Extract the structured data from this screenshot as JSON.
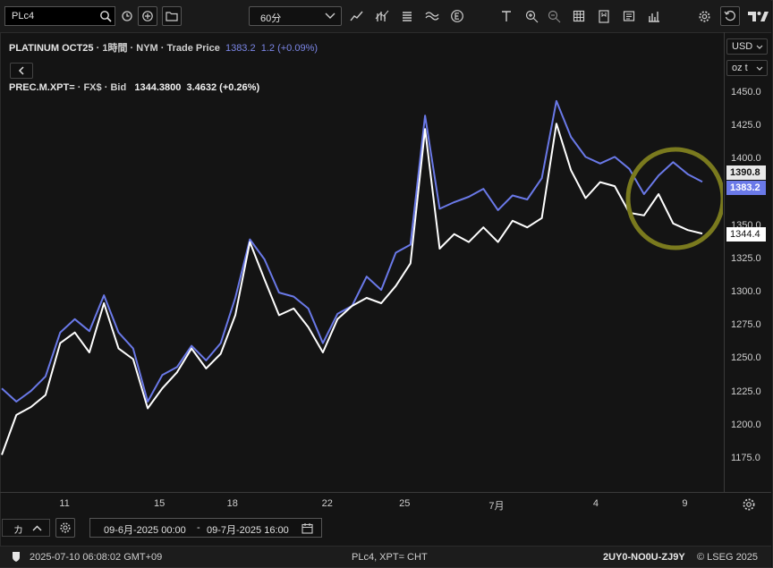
{
  "toolbar": {
    "ric": "PLc4",
    "interval": "60分",
    "icons": [
      "search-icon",
      "clock-icon",
      "add-icon",
      "folder-icon",
      "line-chart-icon",
      "ohlc-icon",
      "list-icon",
      "wave-icon",
      "e-icon",
      "text-tool-icon",
      "zoom-in-icon",
      "zoom-out-icon",
      "table-icon",
      "bookmark-icon",
      "news-icon",
      "bar-chart-icon",
      "settings-icon",
      "reset-icon",
      "tradingview-logo"
    ]
  },
  "header1": {
    "symbol": "PLATINUM OCT25",
    "interval": "1時間",
    "exchange": "NYM",
    "field": "Trade Price",
    "price": "1383.2",
    "change": "1.2 (+0.09%)"
  },
  "header2": {
    "symbol": "PREC.M.XPT=",
    "ccy": "FX$",
    "field": "Bid",
    "price": "1344.3800",
    "change": "3.4632 (+0.26%)"
  },
  "axis": {
    "currency": "USD",
    "unit": "oz t"
  },
  "price_labels": {
    "gray": "1390.8",
    "blue": "1383.2",
    "white": "1344.4"
  },
  "bottom": {
    "k_label": "カ",
    "date_from": "09-6月-2025 00:00",
    "sep": "-",
    "date_to": "09-7月-2025 16:00"
  },
  "status": {
    "timestamp": "2025-07-10 06:08:02 GMT+09",
    "center": "PLc4, XPT= CHT",
    "id": "2UY0-NO0U-ZJ9Y",
    "copyright": "© LSEG 2025"
  },
  "colors": {
    "series_blue": "#6a79e8",
    "series_white": "#ffffff",
    "highlight": "#7a7a1e",
    "background": "#141414"
  },
  "chart_data": {
    "type": "line",
    "x_ticks": [
      "11",
      "15",
      "18",
      "22",
      "25",
      "7月",
      "4",
      "9"
    ],
    "x_tick_pos": [
      4.3,
      10.8,
      15.8,
      22.3,
      27.6,
      33.9,
      40.7,
      46.8
    ],
    "ylim": [
      1150,
      1460
    ],
    "y_ticks": [
      1175,
      1200,
      1225,
      1250,
      1275,
      1300,
      1325,
      1350,
      1375,
      1400,
      1425,
      1450
    ],
    "series": [
      {
        "name": "PLATINUM OCT25",
        "color": "#6a79e8",
        "x": [
          0,
          1,
          2,
          3,
          4,
          5,
          6,
          7,
          8,
          9,
          10,
          11,
          12,
          13,
          14,
          15,
          16,
          17,
          18,
          19,
          20,
          21,
          22,
          23,
          24,
          25,
          26,
          27,
          28,
          29,
          30,
          31,
          32,
          33,
          34,
          35,
          36,
          37,
          38,
          39,
          40,
          41,
          42,
          43,
          44,
          45,
          46,
          47,
          48
        ],
        "values": [
          1228,
          1218,
          1226,
          1237,
          1270,
          1280,
          1271,
          1298,
          1270,
          1258,
          1218,
          1238,
          1244,
          1260,
          1249,
          1262,
          1296,
          1340,
          1325,
          1300,
          1297,
          1288,
          1262,
          1284,
          1290,
          1312,
          1302,
          1330,
          1336,
          1433,
          1363,
          1368,
          1372,
          1378,
          1362,
          1373,
          1370,
          1386,
          1444,
          1417,
          1402,
          1397,
          1402,
          1393,
          1374,
          1388,
          1398,
          1389,
          1383.2
        ]
      },
      {
        "name": "PREC.M.XPT=",
        "color": "#ffffff",
        "x": [
          0,
          1,
          2,
          3,
          4,
          5,
          6,
          7,
          8,
          9,
          10,
          11,
          12,
          13,
          14,
          15,
          16,
          17,
          18,
          19,
          20,
          21,
          22,
          23,
          24,
          25,
          26,
          27,
          28,
          29,
          30,
          31,
          32,
          33,
          34,
          35,
          36,
          37,
          38,
          39,
          40,
          41,
          42,
          43,
          44,
          45,
          46,
          47,
          48
        ],
        "values": [
          1178,
          1208,
          1214,
          1223,
          1262,
          1270,
          1255,
          1292,
          1258,
          1250,
          1213,
          1228,
          1240,
          1258,
          1243,
          1254,
          1283,
          1338,
          1310,
          1283,
          1288,
          1274,
          1255,
          1280,
          1290,
          1296,
          1292,
          1305,
          1322,
          1423,
          1333,
          1344,
          1338,
          1349,
          1338,
          1354,
          1349,
          1356,
          1427,
          1392,
          1371,
          1383,
          1380,
          1360,
          1358,
          1374,
          1352,
          1347,
          1344.4
        ]
      }
    ]
  }
}
